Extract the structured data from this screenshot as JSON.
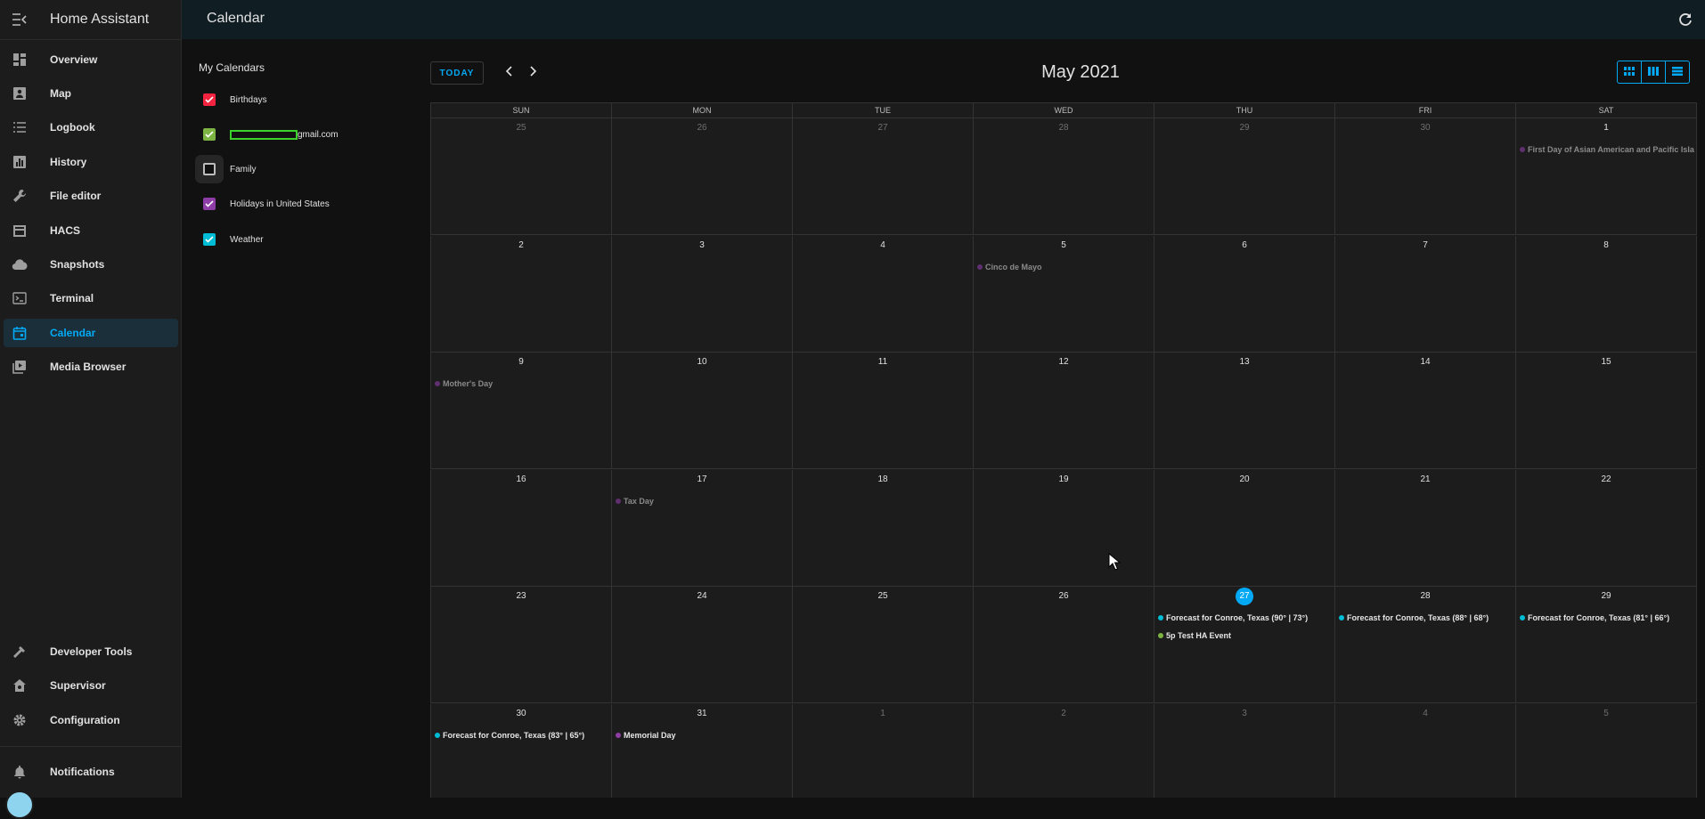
{
  "app": {
    "title": "Home Assistant"
  },
  "sidebar": {
    "items": [
      {
        "label": "Overview",
        "icon": "dashboard-icon"
      },
      {
        "label": "Map",
        "icon": "map-icon"
      },
      {
        "label": "Logbook",
        "icon": "list-icon"
      },
      {
        "label": "History",
        "icon": "chart-icon"
      },
      {
        "label": "File editor",
        "icon": "wrench-icon"
      },
      {
        "label": "HACS",
        "icon": "hacs-icon"
      },
      {
        "label": "Snapshots",
        "icon": "cloud-icon"
      },
      {
        "label": "Terminal",
        "icon": "terminal-icon"
      },
      {
        "label": "Calendar",
        "icon": "calendar-icon",
        "active": true
      },
      {
        "label": "Media Browser",
        "icon": "media-icon"
      }
    ],
    "bottom_items": [
      {
        "label": "Developer Tools",
        "icon": "hammer-icon"
      },
      {
        "label": "Supervisor",
        "icon": "supervisor-icon"
      },
      {
        "label": "Configuration",
        "icon": "gear-icon"
      }
    ],
    "notifications": {
      "label": "Notifications",
      "icon": "bell-icon"
    }
  },
  "header": {
    "title": "Calendar"
  },
  "calendars": {
    "heading": "My Calendars",
    "items": [
      {
        "name": "Birthdays",
        "checked": true,
        "color": "#f4233f"
      },
      {
        "name": "gmail.com",
        "checked": true,
        "color": "#7cb342",
        "redacted": true
      },
      {
        "name": "Family",
        "checked": false,
        "color": "#bdbdbd"
      },
      {
        "name": "Holidays in United States",
        "checked": true,
        "color": "#8e3ca6"
      },
      {
        "name": "Weather",
        "checked": true,
        "color": "#00bcd4"
      }
    ]
  },
  "toolbar": {
    "today_label": "TODAY",
    "month_title": "May 2021"
  },
  "weekdays": [
    "SUN",
    "MON",
    "TUE",
    "WED",
    "THU",
    "FRI",
    "SAT"
  ],
  "weeks": [
    [
      {
        "d": "25",
        "o": true
      },
      {
        "d": "26",
        "o": true
      },
      {
        "d": "27",
        "o": true
      },
      {
        "d": "28",
        "o": true
      },
      {
        "d": "29",
        "o": true
      },
      {
        "d": "30",
        "o": true
      },
      {
        "d": "1"
      }
    ],
    [
      {
        "d": "2"
      },
      {
        "d": "3"
      },
      {
        "d": "4"
      },
      {
        "d": "5"
      },
      {
        "d": "6"
      },
      {
        "d": "7"
      },
      {
        "d": "8"
      }
    ],
    [
      {
        "d": "9"
      },
      {
        "d": "10"
      },
      {
        "d": "11"
      },
      {
        "d": "12"
      },
      {
        "d": "13"
      },
      {
        "d": "14"
      },
      {
        "d": "15"
      }
    ],
    [
      {
        "d": "16"
      },
      {
        "d": "17"
      },
      {
        "d": "18"
      },
      {
        "d": "19"
      },
      {
        "d": "20"
      },
      {
        "d": "21"
      },
      {
        "d": "22"
      }
    ],
    [
      {
        "d": "23"
      },
      {
        "d": "24"
      },
      {
        "d": "25"
      },
      {
        "d": "26"
      },
      {
        "d": "27",
        "today": true
      },
      {
        "d": "28"
      },
      {
        "d": "29"
      }
    ],
    [
      {
        "d": "30"
      },
      {
        "d": "31"
      },
      {
        "d": "1",
        "o": true
      },
      {
        "d": "2",
        "o": true
      },
      {
        "d": "3",
        "o": true
      },
      {
        "d": "4",
        "o": true
      },
      {
        "d": "5",
        "o": true
      }
    ]
  ],
  "events": [
    {
      "week": 0,
      "day": 6,
      "slot": 0,
      "title": "First Day of Asian American and Pacific Isla",
      "color": "#8e3ca6",
      "past": true
    },
    {
      "week": 1,
      "day": 3,
      "slot": 0,
      "title": "Cinco de Mayo",
      "color": "#8e3ca6",
      "past": true
    },
    {
      "week": 2,
      "day": 0,
      "slot": 0,
      "title": "Mother's Day",
      "color": "#8e3ca6",
      "past": true
    },
    {
      "week": 3,
      "day": 1,
      "slot": 0,
      "title": "Tax Day",
      "color": "#8e3ca6",
      "past": true
    },
    {
      "week": 4,
      "day": 4,
      "slot": 0,
      "title": "Forecast for Conroe, Texas (90° | 73°)",
      "color": "#00bcd4",
      "past": false
    },
    {
      "week": 4,
      "day": 4,
      "slot": 1,
      "title": "5p Test HA Event",
      "color": "#7cb342",
      "past": false
    },
    {
      "week": 4,
      "day": 5,
      "slot": 0,
      "title": "Forecast for Conroe, Texas (88° | 68°)",
      "color": "#00bcd4",
      "past": false
    },
    {
      "week": 4,
      "day": 6,
      "slot": 0,
      "title": "Forecast for Conroe, Texas (81° | 66°)",
      "color": "#00bcd4",
      "past": false
    },
    {
      "week": 5,
      "day": 0,
      "slot": 0,
      "title": "Forecast for Conroe, Texas (83° | 65°)",
      "color": "#00bcd4",
      "past": false
    },
    {
      "week": 5,
      "day": 1,
      "slot": 0,
      "title": "Memorial Day",
      "color": "#8e3ca6",
      "past": false
    }
  ],
  "colors": {
    "accent": "#03a9f4",
    "background": "#111111",
    "card": "#1c1c1c"
  }
}
